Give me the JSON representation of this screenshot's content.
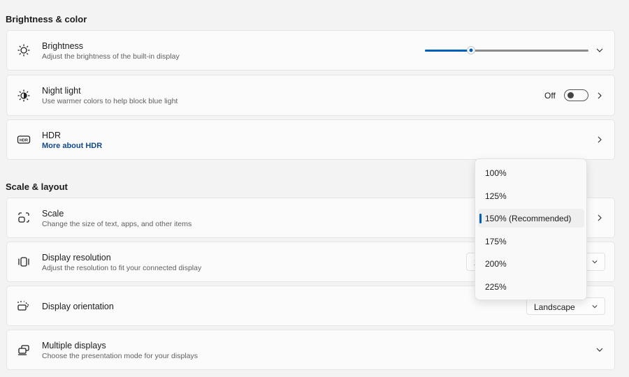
{
  "sections": {
    "brightness_color": "Brightness & color",
    "scale_layout": "Scale & layout"
  },
  "brightness": {
    "title": "Brightness",
    "subtitle": "Adjust the brightness of the built-in display",
    "value_percent": 28
  },
  "night_light": {
    "title": "Night light",
    "subtitle": "Use warmer colors to help block blue light",
    "state": "Off",
    "on": false
  },
  "hdr": {
    "title": "HDR",
    "link": "More about HDR"
  },
  "scale": {
    "title": "Scale",
    "subtitle": "Change the size of text, apps, and other items",
    "options": [
      "100%",
      "125%",
      "150% (Recommended)",
      "175%",
      "200%",
      "225%"
    ],
    "selected": "150% (Recommended)"
  },
  "resolution": {
    "title": "Display resolution",
    "subtitle": "Adjust the resolution to fit your connected display",
    "value_visible": "2"
  },
  "orientation": {
    "title": "Display orientation",
    "value": "Landscape"
  },
  "multiple": {
    "title": "Multiple displays",
    "subtitle": "Choose the presentation mode for your displays"
  },
  "colors": {
    "accent": "#005fb8",
    "link": "#134a8c"
  }
}
